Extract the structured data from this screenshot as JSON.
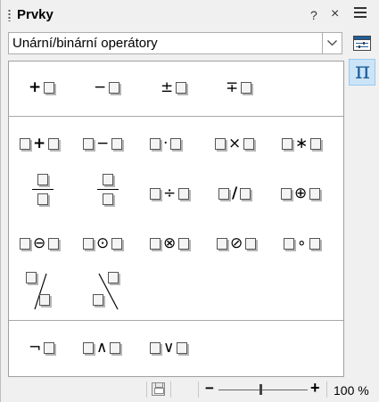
{
  "header": {
    "title": "Prvky",
    "help_label": "?",
    "close_label": "×"
  },
  "dropdown": {
    "value": "Unární/binární operátory"
  },
  "sidebar": {
    "pi_label": "π"
  },
  "elements": {
    "row1": [
      "+",
      "−",
      "±",
      "∓"
    ],
    "row2": [
      "+",
      "−",
      "·",
      "×",
      "∗"
    ],
    "row3": [
      "÷",
      "/",
      "⊕"
    ],
    "row4": [
      "⊖",
      "⊙",
      "⊗",
      "⊘",
      "∘"
    ],
    "row6": [
      "¬",
      "∧",
      "∨"
    ]
  },
  "status": {
    "zoom": "100 %",
    "zoom_out": "−",
    "zoom_in": "+"
  }
}
